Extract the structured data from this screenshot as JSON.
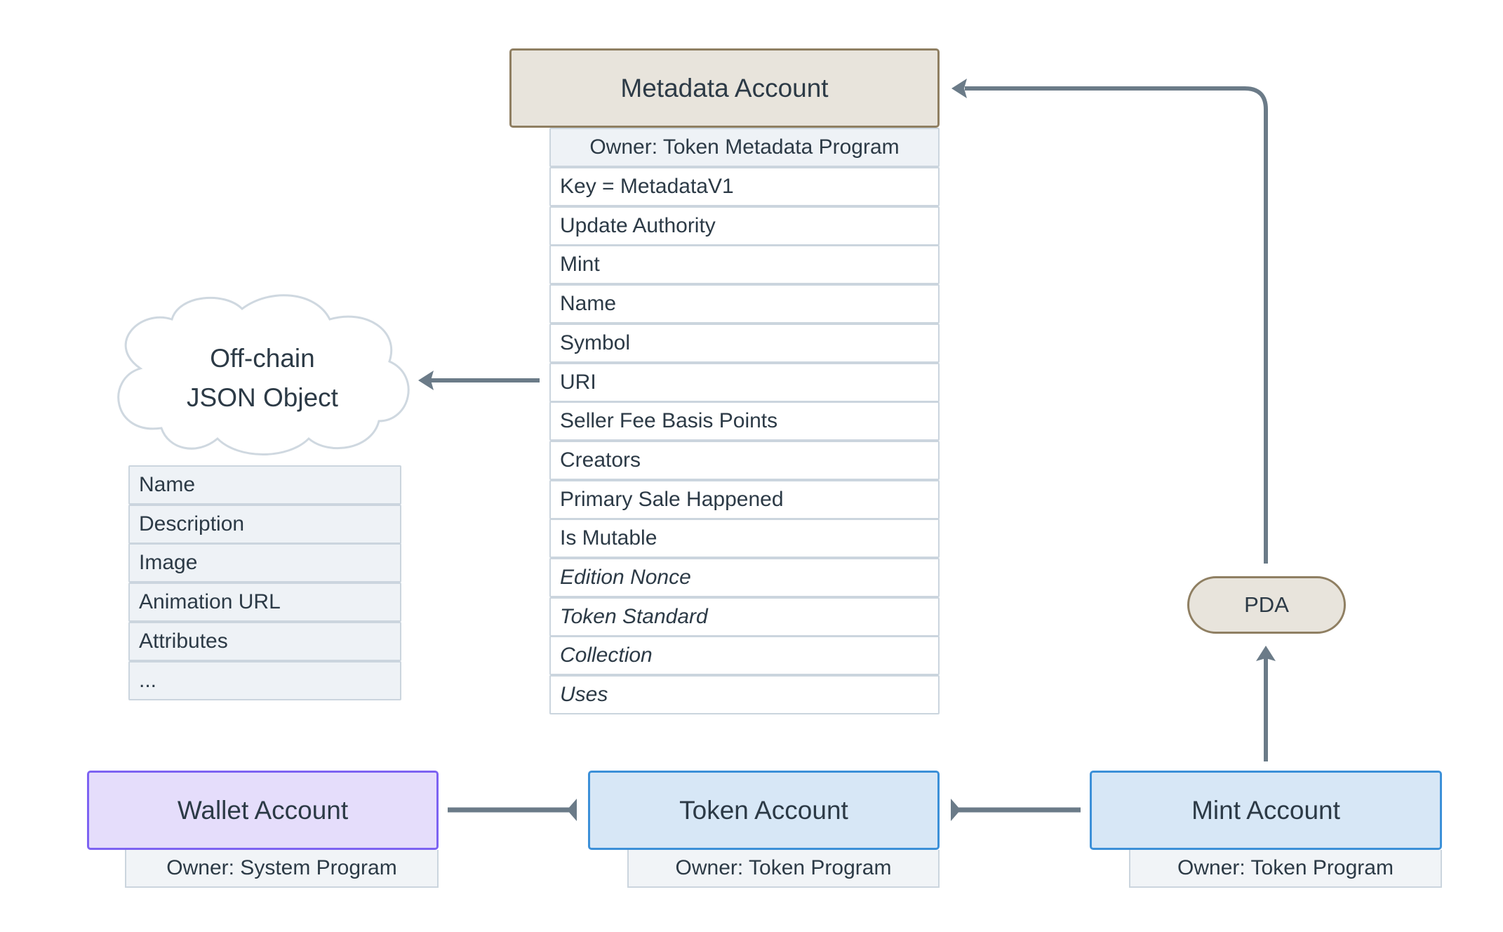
{
  "metadata_account": {
    "title": "Metadata Account",
    "owner": "Owner: Token Metadata Program",
    "fields": [
      {
        "label": "Key = MetadataV1",
        "italic": false
      },
      {
        "label": "Update Authority",
        "italic": false
      },
      {
        "label": "Mint",
        "italic": false
      },
      {
        "label": "Name",
        "italic": false
      },
      {
        "label": "Symbol",
        "italic": false
      },
      {
        "label": "URI",
        "italic": false
      },
      {
        "label": "Seller Fee Basis Points",
        "italic": false
      },
      {
        "label": "Creators",
        "italic": false
      },
      {
        "label": "Primary Sale Happened",
        "italic": false
      },
      {
        "label": "Is Mutable",
        "italic": false
      },
      {
        "label": "Edition Nonce",
        "italic": true
      },
      {
        "label": "Token Standard",
        "italic": true
      },
      {
        "label": "Collection",
        "italic": true
      },
      {
        "label": "Uses",
        "italic": true
      }
    ]
  },
  "offchain": {
    "title_line1": "Off-chain",
    "title_line2": "JSON Object",
    "fields": [
      "Name",
      "Description",
      "Image",
      "Animation URL",
      "Attributes",
      "..."
    ]
  },
  "pda": {
    "label": "PDA"
  },
  "wallet_account": {
    "title": "Wallet Account",
    "owner": "Owner: System Program"
  },
  "token_account": {
    "title": "Token Account",
    "owner": "Owner: Token Program"
  },
  "mint_account": {
    "title": "Mint Account",
    "owner": "Owner: Token Program"
  },
  "colors": {
    "arrow": "#6b7b88",
    "wallet": "#7d63f2",
    "token": "#3c90d8",
    "metadata": "#8f7f62"
  }
}
